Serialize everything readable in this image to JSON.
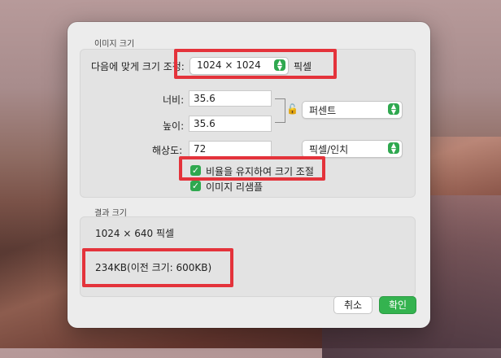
{
  "image_size": {
    "section_label": "이미지 크기",
    "fit_label": "다음에 맞게 크기 조정:",
    "fit_value": "1024 × 1024",
    "fit_unit": "픽셀",
    "width_label": "너비:",
    "width_value": "35.6",
    "height_label": "높이:",
    "height_value": "35.6",
    "unit_value": "퍼센트",
    "resolution_label": "해상도:",
    "resolution_value": "72",
    "resolution_unit": "픽셀/인치",
    "keep_ratio_label": "비율을 유지하여 크기 조절",
    "resample_label": "이미지 리샘플"
  },
  "result": {
    "section_label": "결과 크기",
    "dimensions": "1024 × 640 픽셀",
    "file_size": "234KB(이전 크기: 600KB)"
  },
  "buttons": {
    "cancel": "취소",
    "ok": "확인"
  },
  "colors": {
    "accent_green": "#2fa84f",
    "highlight_red": "#e4333b"
  }
}
